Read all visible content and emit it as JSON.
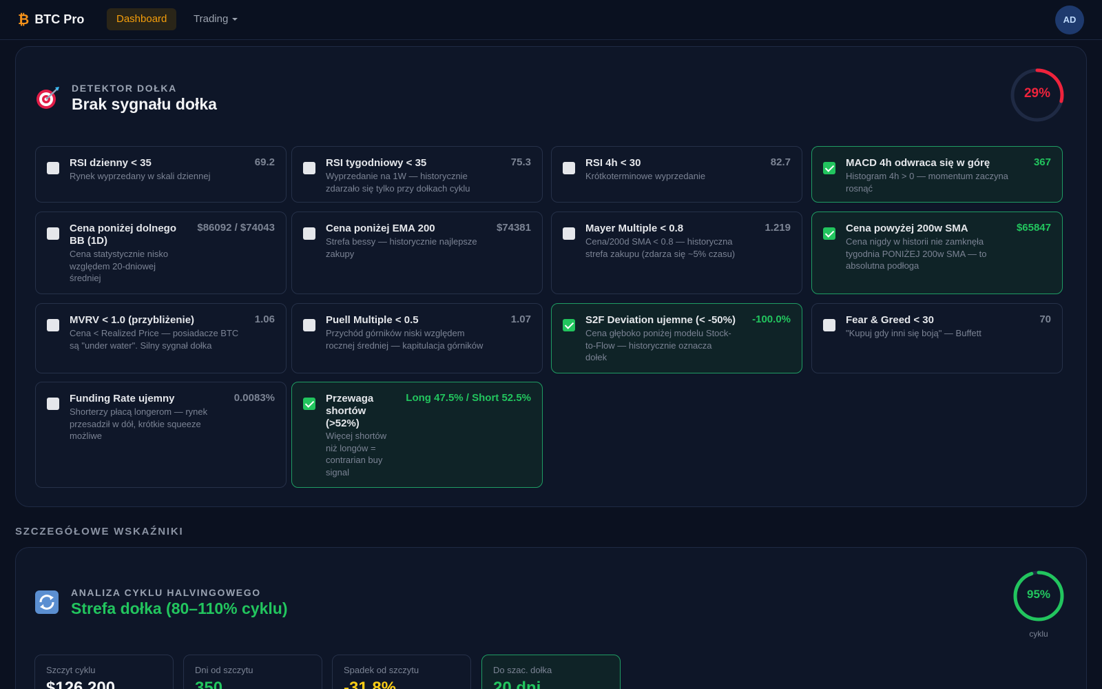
{
  "nav": {
    "brand_icon": "₿",
    "brand_name": "BTC Pro",
    "items": [
      "Dashboard",
      "Trading"
    ],
    "avatar": "AD"
  },
  "detector": {
    "icon": "target-icon",
    "eyebrow": "DETEKTOR DOŁKA",
    "title": "Brak sygnału dołka",
    "score": "29%",
    "score_fraction": 0.29,
    "score_color": "#ef233c",
    "cards": [
      {
        "title": "RSI dzienny < 35",
        "value": "69.2",
        "desc": [
          "Rynek wyprzedany w skali dziennej"
        ],
        "checked": false
      },
      {
        "title": "RSI tygodniowy < 35",
        "value": "75.3",
        "desc": [
          "Wyprzedanie na 1W — historycznie",
          "zdarzało się tylko przy dołkach cyklu"
        ],
        "checked": false
      },
      {
        "title": "RSI 4h < 30",
        "value": "82.7",
        "desc": [
          "Krótkoterminowe wyprzedanie"
        ],
        "checked": false
      },
      {
        "title": "MACD 4h odwraca się w górę",
        "value": "367",
        "desc": [
          "Histogram 4h > 0 — momentum zaczyna",
          "rosnąć"
        ],
        "checked": true
      },
      {
        "title": "Cena poniżej dolnego BB (1D)",
        "value": "$86092 / $74043",
        "desc": [
          "Cena statystycznie nisko",
          "względem 20-dniowej",
          "średniej"
        ],
        "checked": false
      },
      {
        "title": "Cena poniżej EMA 200",
        "value": "$74381",
        "desc": [
          "Strefa bessy — historycznie najlepsze",
          "zakupy"
        ],
        "checked": false
      },
      {
        "title": "Mayer Multiple < 0.8",
        "value": "1.219",
        "desc": [
          "Cena/200d SMA < 0.8 — historyczna",
          "strefa zakupu (zdarza się ~5% czasu)"
        ],
        "checked": false
      },
      {
        "title": "Cena powyżej 200w SMA",
        "value": "$65847",
        "desc": [
          "Cena nigdy w historii nie zamknęła",
          "tygodnia PONIŻEJ 200w SMA — to",
          "absolutna podłoga"
        ],
        "checked": true
      },
      {
        "title": "MVRV < 1.0 (przybliżenie)",
        "value": "1.06",
        "desc": [
          "Cena < Realized Price — posiadacze BTC",
          "są \"under water\". Silny sygnał dołka"
        ],
        "checked": false
      },
      {
        "title": "Puell Multiple < 0.5",
        "value": "1.07",
        "desc": [
          "Przychód górników niski względem",
          "rocznej średniej — kapitulacja górników"
        ],
        "checked": false
      },
      {
        "title": "S2F Deviation ujemne (< -50%)",
        "value": "-100.0%",
        "desc": [
          "Cena głęboko poniżej modelu Stock-",
          "to-Flow — historycznie oznacza",
          "dołek"
        ],
        "checked": true
      },
      {
        "title": "Fear & Greed < 30",
        "value": "70",
        "desc": [
          "\"Kupuj gdy inni się boją\" — Buffett"
        ],
        "checked": false
      },
      {
        "title": "Funding Rate ujemny",
        "value": "0.0083%",
        "desc": [
          "Shorterzy płacą longerom — rynek",
          "przesadził w dół, krótkie squeeze",
          "możliwe"
        ],
        "checked": false
      },
      {
        "title": "Przewaga shortów (>52%)",
        "value": "Long 47.5% / Short 52.5%",
        "desc": [
          "Więcej shortów",
          "niż longów =",
          "contrarian buy",
          "signal"
        ],
        "checked": true
      }
    ]
  },
  "section_label": "SZCZEGÓŁOWE WSKAŹNIKI",
  "halving": {
    "icon": "cycle-arrows-icon",
    "eyebrow": "ANALIZA CYKLU HALVINGOWEGO",
    "title": "Strefa dołka (80–110% cyklu)",
    "title_color": "#22c55e",
    "gauge_value": "95%",
    "gauge_fraction": 0.95,
    "gauge_color": "#22c55e",
    "gauge_caption": "cyklu",
    "stats": [
      {
        "label": "Szczyt cyklu",
        "value": "$126,200",
        "color": "#f3f4f6"
      },
      {
        "label": "Dni od szczytu",
        "value": "350",
        "color": "#22c55e"
      },
      {
        "label": "Spadek od szczytu",
        "value": "-31.8%",
        "color": "#facc15"
      },
      {
        "label": "Do szac. dołka",
        "value": "20 dni",
        "color": "#22c55e"
      }
    ]
  }
}
